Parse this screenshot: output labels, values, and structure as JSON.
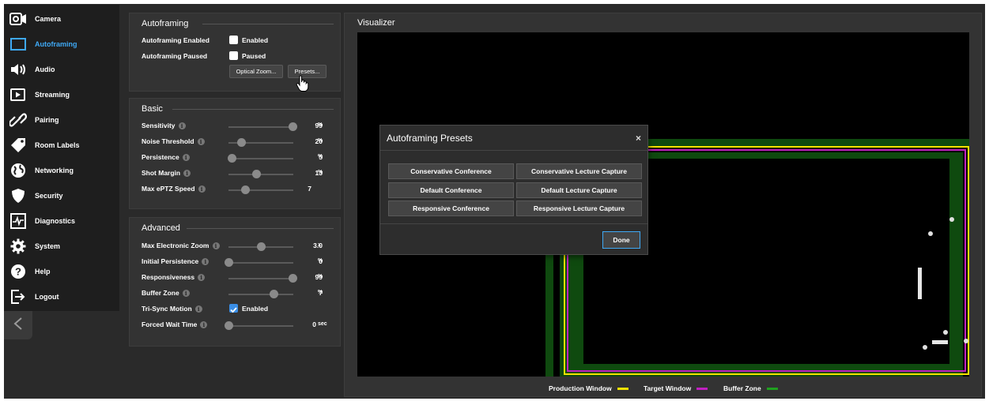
{
  "sidebar": {
    "items": [
      {
        "label": "Camera",
        "icon": "camera-icon"
      },
      {
        "label": "Autoframing",
        "icon": "autoframing-icon",
        "active": true
      },
      {
        "label": "Audio",
        "icon": "speaker-icon"
      },
      {
        "label": "Streaming",
        "icon": "play-icon"
      },
      {
        "label": "Pairing",
        "icon": "link-icon"
      },
      {
        "label": "Room Labels",
        "icon": "tag-icon"
      },
      {
        "label": "Networking",
        "icon": "globe-icon"
      },
      {
        "label": "Security",
        "icon": "shield-icon"
      },
      {
        "label": "Diagnostics",
        "icon": "pulse-icon"
      },
      {
        "label": "System",
        "icon": "gear-icon"
      },
      {
        "label": "Help",
        "icon": "help-icon"
      },
      {
        "label": "Logout",
        "icon": "logout-icon"
      }
    ],
    "accent_color": "#3fa9f5"
  },
  "autoframing": {
    "title": "Autoframing",
    "enabled_label": "Autoframing Enabled",
    "enabled_check_label": "Enabled",
    "enabled_checked": false,
    "paused_label": "Autoframing Paused",
    "paused_check_label": "Paused",
    "paused_checked": false,
    "optical_zoom_button": "Optical Zoom...",
    "presets_button": "Presets..."
  },
  "basic": {
    "title": "Basic",
    "rows": [
      {
        "label": "Sensitivity",
        "value": "99",
        "unit": "%",
        "fraction": 0.99
      },
      {
        "label": "Noise Threshold",
        "value": "20",
        "unit": "%",
        "fraction": 0.2
      },
      {
        "label": "Persistence",
        "value": "5",
        "unit": "%",
        "fraction": 0.05
      },
      {
        "label": "Shot Margin",
        "value": "13",
        "unit": "%",
        "fraction": 0.43
      },
      {
        "label": "Max ePTZ Speed",
        "value": "7",
        "unit": "",
        "fraction": 0.25
      }
    ]
  },
  "advanced": {
    "title": "Advanced",
    "rows": [
      {
        "label": "Max Electronic Zoom",
        "value": "3.0",
        "unit": "x",
        "fraction": 0.5
      },
      {
        "label": "Initial Persistence",
        "value": "0",
        "unit": "%",
        "fraction": 0.0
      },
      {
        "label": "Responsiveness",
        "value": "99",
        "unit": "%",
        "fraction": 0.99
      },
      {
        "label": "Buffer Zone",
        "value": "7",
        "unit": "%",
        "fraction": 0.7
      }
    ],
    "tri_sync_label": "Tri-Sync Motion",
    "tri_sync_check_label": "Enabled",
    "tri_sync_checked": true,
    "forced_wait_label": "Forced Wait Time",
    "forced_wait_value": "0",
    "forced_wait_unit": "sec",
    "forced_wait_fraction": 0.0
  },
  "visualizer": {
    "title": "Visualizer",
    "legend": [
      {
        "label": "Production Window",
        "color": "#f5e300"
      },
      {
        "label": "Target Window",
        "color": "#c020c0"
      },
      {
        "label": "Buffer Zone",
        "color": "#1fa01f"
      }
    ]
  },
  "modal": {
    "title": "Autoframing Presets",
    "close_glyph": "×",
    "presets": [
      "Conservative Conference",
      "Conservative Lecture Capture",
      "Default Conference",
      "Default Lecture Capture",
      "Responsive Conference",
      "Responsive Lecture Capture"
    ],
    "done_label": "Done"
  }
}
